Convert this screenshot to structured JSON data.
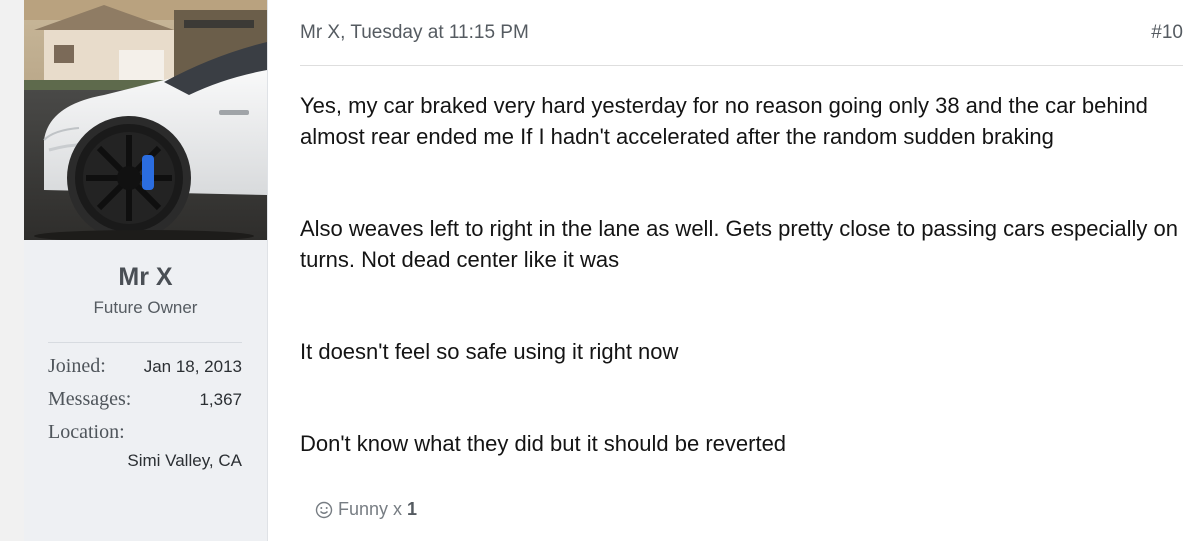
{
  "user": {
    "name": "Mr X",
    "title": "Future Owner",
    "avatar_icon": "avatar-white-car-photo",
    "stats": [
      {
        "label": "Joined:",
        "value": "Jan 18, 2013"
      },
      {
        "label": "Messages:",
        "value": "1,367"
      },
      {
        "label": "Location:",
        "value": "Simi Valley, CA"
      }
    ]
  },
  "post": {
    "header": "Mr X, Tuesday at 11:15 PM",
    "number": "#10",
    "paragraphs": [
      "Yes, my car braked very hard yesterday for no reason going only 38 and the car behind almost rear ended me If I hadn't accelerated after the random sudden braking",
      "Also weaves left to right in the lane as well. Gets pretty close to passing cars especially on turns. Not dead center like it was",
      "It doesn't feel so safe using it right now",
      "Don't know what they did but it should be reverted"
    ],
    "reaction": {
      "label": "Funny x",
      "count": "1",
      "icon": "smile-icon"
    }
  }
}
